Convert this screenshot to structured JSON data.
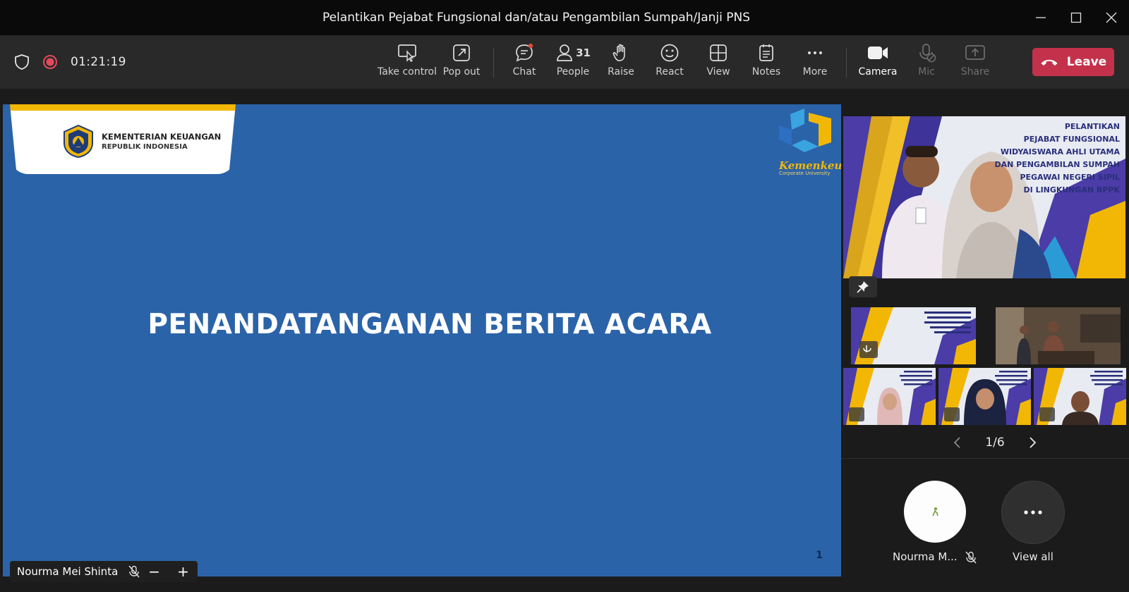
{
  "window": {
    "title": "Pelantikan Pejabat Fungsional dan/atau Pengambilan Sumpah/Janji PNS"
  },
  "toolbar": {
    "timer": "01:21:19",
    "buttons": {
      "take_control": "Take control",
      "pop_out": "Pop out",
      "chat": "Chat",
      "people": "People",
      "people_count": "31",
      "raise": "Raise",
      "react": "React",
      "view": "View",
      "notes": "Notes",
      "more": "More",
      "camera": "Camera",
      "mic": "Mic",
      "share": "Share"
    },
    "leave_label": "Leave"
  },
  "slide": {
    "org_name": "KEMENTERIAN KEUANGAN",
    "org_sub": "REPUBLIK INDONESIA",
    "corp_name": "Kemenkeu",
    "corp_sub": "Corporate University",
    "title": "PENANDATANGANAN BERITA ACARA",
    "page_number": "1"
  },
  "presenter": {
    "name": "Nourma Mei Shinta"
  },
  "zoom": {
    "minus": "−",
    "plus": "+"
  },
  "featured": {
    "lines": [
      "PELANTIKAN",
      "PEJABAT FUNGSIONAL",
      "WIDYAISWARA AHLI UTAMA",
      "DAN PENGAMBILAN SUMPAH",
      "PEGAWAI NEGERI SIPIL",
      "DI LINGKUNGAN BPPK"
    ]
  },
  "pagination": {
    "label": "1/6"
  },
  "bottom": {
    "user_name": "Nourma M...",
    "view_all": "View all"
  },
  "colors": {
    "accent_red": "#c4314b",
    "slide_blue": "#2b63a8",
    "gold": "#f2b705",
    "purple": "#4b3ca8"
  }
}
